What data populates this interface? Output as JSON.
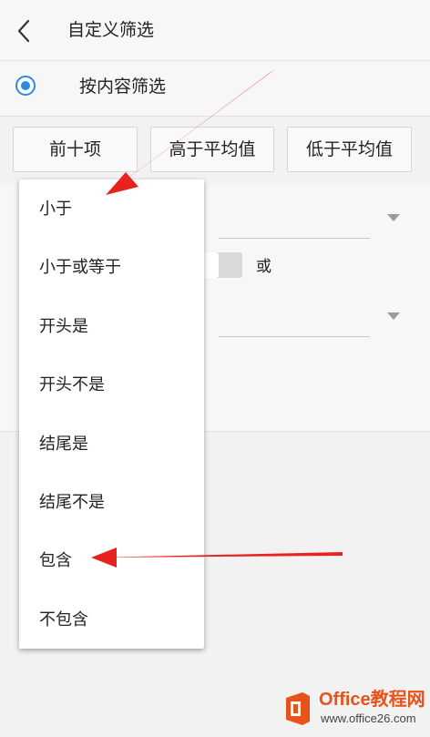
{
  "header": {
    "back_icon": "chevron-left-icon",
    "title": "自定义筛选"
  },
  "filter_mode": {
    "label": "按内容筛选",
    "selected": true,
    "accent_color": "#2d8ae3"
  },
  "presets": [
    {
      "label": "前十项"
    },
    {
      "label": "高于平均值"
    },
    {
      "label": "低于平均值"
    }
  ],
  "conditions": {
    "toggle_on": false,
    "or_label": "或"
  },
  "dropdown": {
    "options": [
      {
        "label": "小于"
      },
      {
        "label": "小于或等于"
      },
      {
        "label": "开头是"
      },
      {
        "label": "开头不是"
      },
      {
        "label": "结尾是"
      },
      {
        "label": "结尾不是"
      },
      {
        "label": "包含"
      },
      {
        "label": "不包含"
      }
    ]
  },
  "annotations": {
    "arrow_color": "#e8231e"
  },
  "watermark": {
    "logo_icon": "office-logo-icon",
    "title": "Office教程网",
    "url": "www.office26.com"
  }
}
